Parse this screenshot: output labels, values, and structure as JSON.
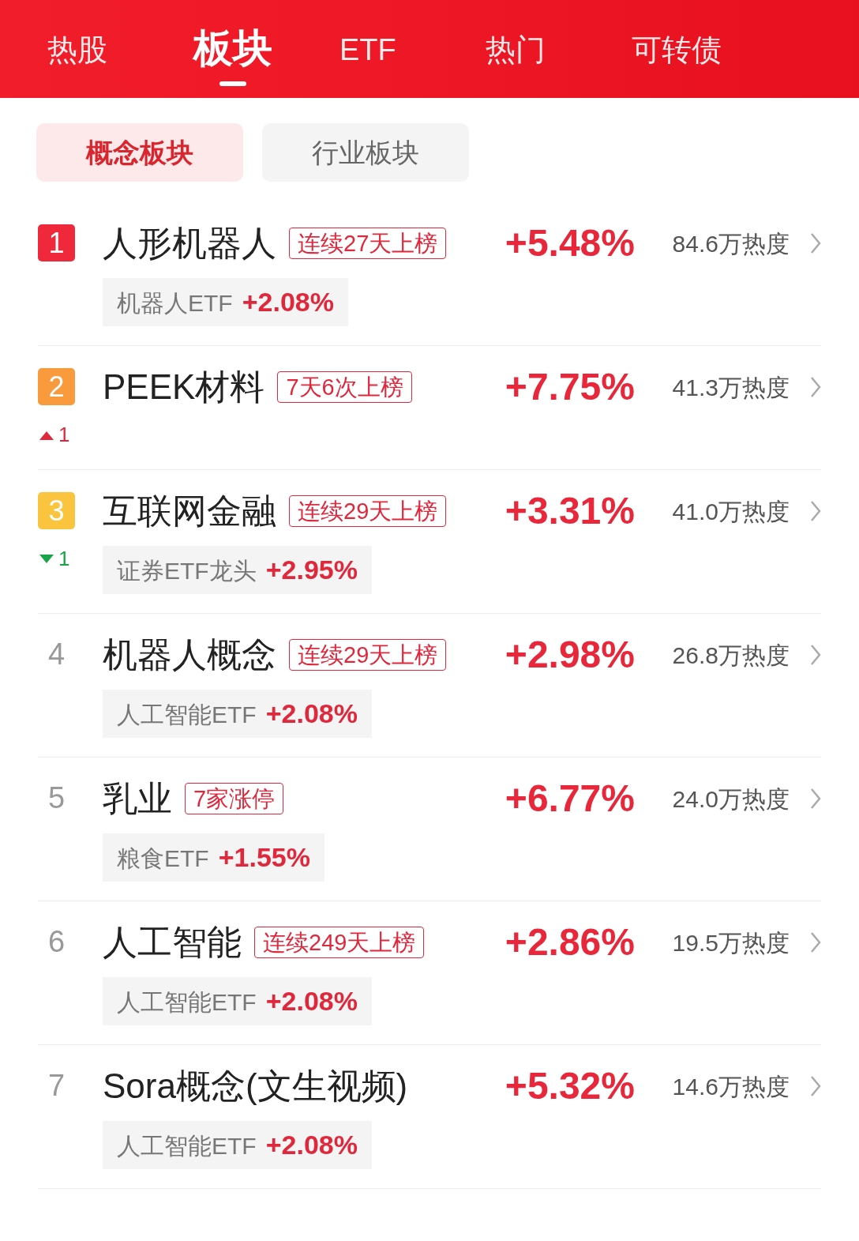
{
  "top_tabs": [
    {
      "label": "热股",
      "selected": false
    },
    {
      "label": "板块",
      "selected": true
    },
    {
      "label": "ETF",
      "selected": false
    },
    {
      "label": "热门",
      "selected": false
    },
    {
      "label": "可转债",
      "selected": false
    }
  ],
  "segments": [
    {
      "label": "概念板块",
      "selected": true
    },
    {
      "label": "行业板块",
      "selected": false
    }
  ],
  "sectors": [
    {
      "rank": "1",
      "kind": "badge",
      "color": "#f0283c",
      "name": "人形机器人",
      "tag": "连续27天上榜",
      "change": "+5.48%",
      "heat": "84.6万热度",
      "etf": {
        "name": "机器人ETF",
        "change": "+2.08%"
      }
    },
    {
      "rank": "2",
      "kind": "badge",
      "color": "#f99a3c",
      "name": "PEEK材料",
      "tag": "7天6次上榜",
      "change": "+7.75%",
      "heat": "41.3万热度",
      "move": {
        "up": true,
        "amount": "1"
      }
    },
    {
      "rank": "3",
      "kind": "badge",
      "color": "#fbc43f",
      "name": "互联网金融",
      "tag": "连续29天上榜",
      "change": "+3.31%",
      "heat": "41.0万热度",
      "move": {
        "up": false,
        "amount": "1"
      },
      "etf": {
        "name": "证券ETF龙头",
        "change": "+2.95%"
      }
    },
    {
      "rank": "4",
      "kind": "plain",
      "name": "机器人概念",
      "tag": "连续29天上榜",
      "change": "+2.98%",
      "heat": "26.8万热度",
      "etf": {
        "name": "人工智能ETF",
        "change": "+2.08%"
      }
    },
    {
      "rank": "5",
      "kind": "plain",
      "name": "乳业",
      "tag": "7家涨停",
      "change": "+6.77%",
      "heat": "24.0万热度",
      "etf": {
        "name": "粮食ETF",
        "change": "+1.55%"
      }
    },
    {
      "rank": "6",
      "kind": "plain",
      "name": "人工智能",
      "tag": "连续249天上榜",
      "change": "+2.86%",
      "heat": "19.5万热度",
      "etf": {
        "name": "人工智能ETF",
        "change": "+2.08%"
      }
    },
    {
      "rank": "7",
      "kind": "plain",
      "name": "Sora概念(文生视频)",
      "change": "+5.32%",
      "heat": "14.6万热度",
      "etf": {
        "name": "人工智能ETF",
        "change": "+2.08%"
      }
    }
  ]
}
